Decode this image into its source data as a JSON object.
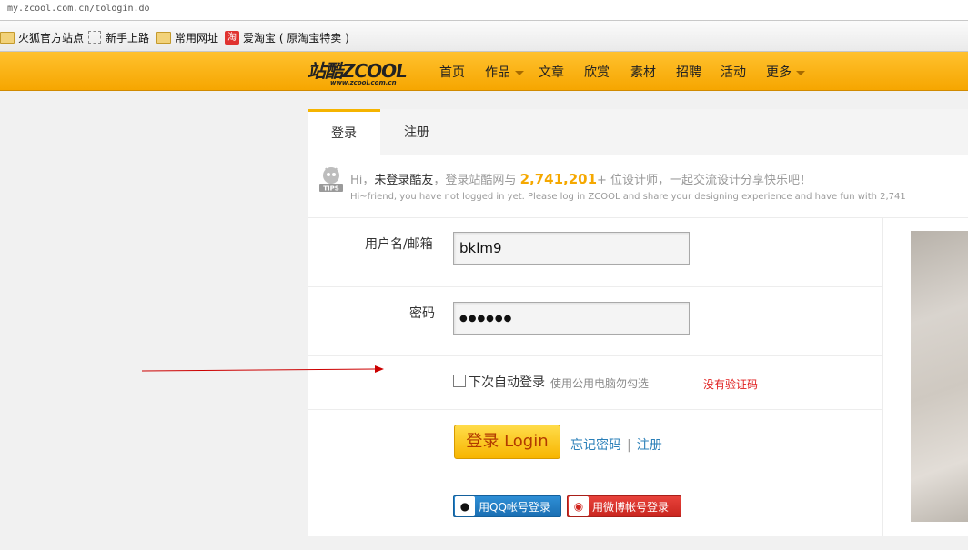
{
  "browser": {
    "url": "my.zcool.com.cn/tologin.do"
  },
  "bookmarks": [
    {
      "label": "火狐官方站点",
      "icon": "folder-icon"
    },
    {
      "label": "新手上路",
      "icon": "dashed-square-icon"
    },
    {
      "label": "常用网址",
      "icon": "folder-icon"
    },
    {
      "label": "爱淘宝 ( 原淘宝特卖 )",
      "icon": "taobao-icon",
      "icon_text": "淘"
    }
  ],
  "site": {
    "logo": "站酷ZCOOL",
    "logo_sub": "www.zcool.com.cn",
    "nav": [
      "首页",
      "作品",
      "文章",
      "欣赏",
      "素材",
      "招聘",
      "活动",
      "更多"
    ]
  },
  "tabs": {
    "login": "登录",
    "register": "注册"
  },
  "tips": {
    "badge": "TIPS",
    "hi": "Hi，",
    "bold": "未登录酷友",
    "mid": "，登录站酷网与",
    "count": "2,741,201",
    "tail": "+ 位设计师，一起交流设计分享快乐吧！",
    "english": "Hi~friend, you have not logged in yet. Please log in ZCOOL and share your designing experience and have fun with 2,741"
  },
  "form": {
    "username_label": "用户名/邮箱",
    "username_value": "bklm9",
    "password_label": "密码",
    "password_value": "●●●●●●",
    "remember_label": "下次自动登录",
    "remember_hint": "使用公用电脑勿勾选",
    "no_captcha": "没有验证码",
    "login_button": "登录 Login",
    "forgot_link": "忘记密码",
    "separator": "|",
    "register_link": "注册",
    "qq_login": "用QQ帐号登录",
    "weibo_login": "用微博帐号登录"
  },
  "colors": {
    "brand": "#f6a600",
    "accent_number": "#f5a800",
    "link": "#2a7fb8",
    "warning": "#e02020",
    "annotation_arrow": "#cc0000"
  }
}
